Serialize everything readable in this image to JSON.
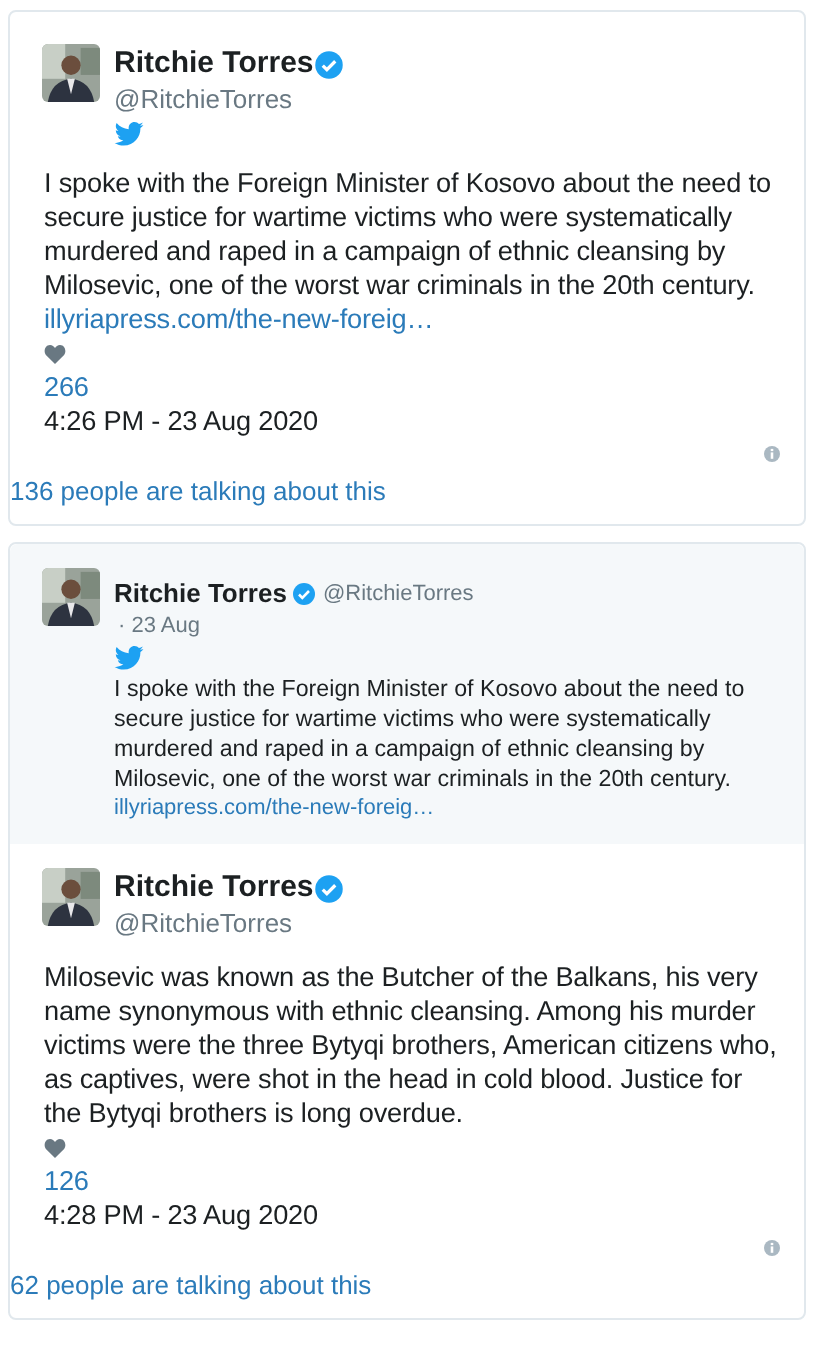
{
  "embeds": [
    {
      "tweet": {
        "name": "Ritchie Torres",
        "verified": true,
        "handle": "@RitchieTorres",
        "text": "I spoke with the Foreign Minister of Kosovo about the need to secure justice for wartime victims who were systematically murdered and raped in a campaign of ethnic cleansing by Milosevic, one of the worst war criminals in the 20th century.",
        "link": "illyriapress.com/the-new-foreig…",
        "likes": "266",
        "timestamp": "4:26 PM - 23 Aug 2020"
      },
      "talking": "136 people are talking about this"
    },
    {
      "quoted": {
        "name": "Ritchie Torres",
        "verified": true,
        "handle": "@RitchieTorres",
        "date": "· 23 Aug",
        "text": "I spoke with the Foreign Minister of Kosovo about the need to secure justice for wartime victims who were systematically murdered and raped in a campaign of ethnic cleansing by Milosevic, one of the worst war criminals in the 20th century.",
        "link": "illyriapress.com/the-new-foreig…"
      },
      "tweet": {
        "name": "Ritchie Torres",
        "verified": true,
        "handle": "@RitchieTorres",
        "text": "Milosevic was known as the Butcher of the Balkans, his very name synonymous with ethnic cleansing. Among his murder victims were the three Bytyqi brothers, American citizens who, as captives, were shot in the head in cold blood. Justice for the Bytyqi brothers is long overdue.",
        "likes": "126",
        "timestamp": "4:28 PM - 23 Aug 2020"
      },
      "talking": "62 people are talking about this"
    }
  ]
}
